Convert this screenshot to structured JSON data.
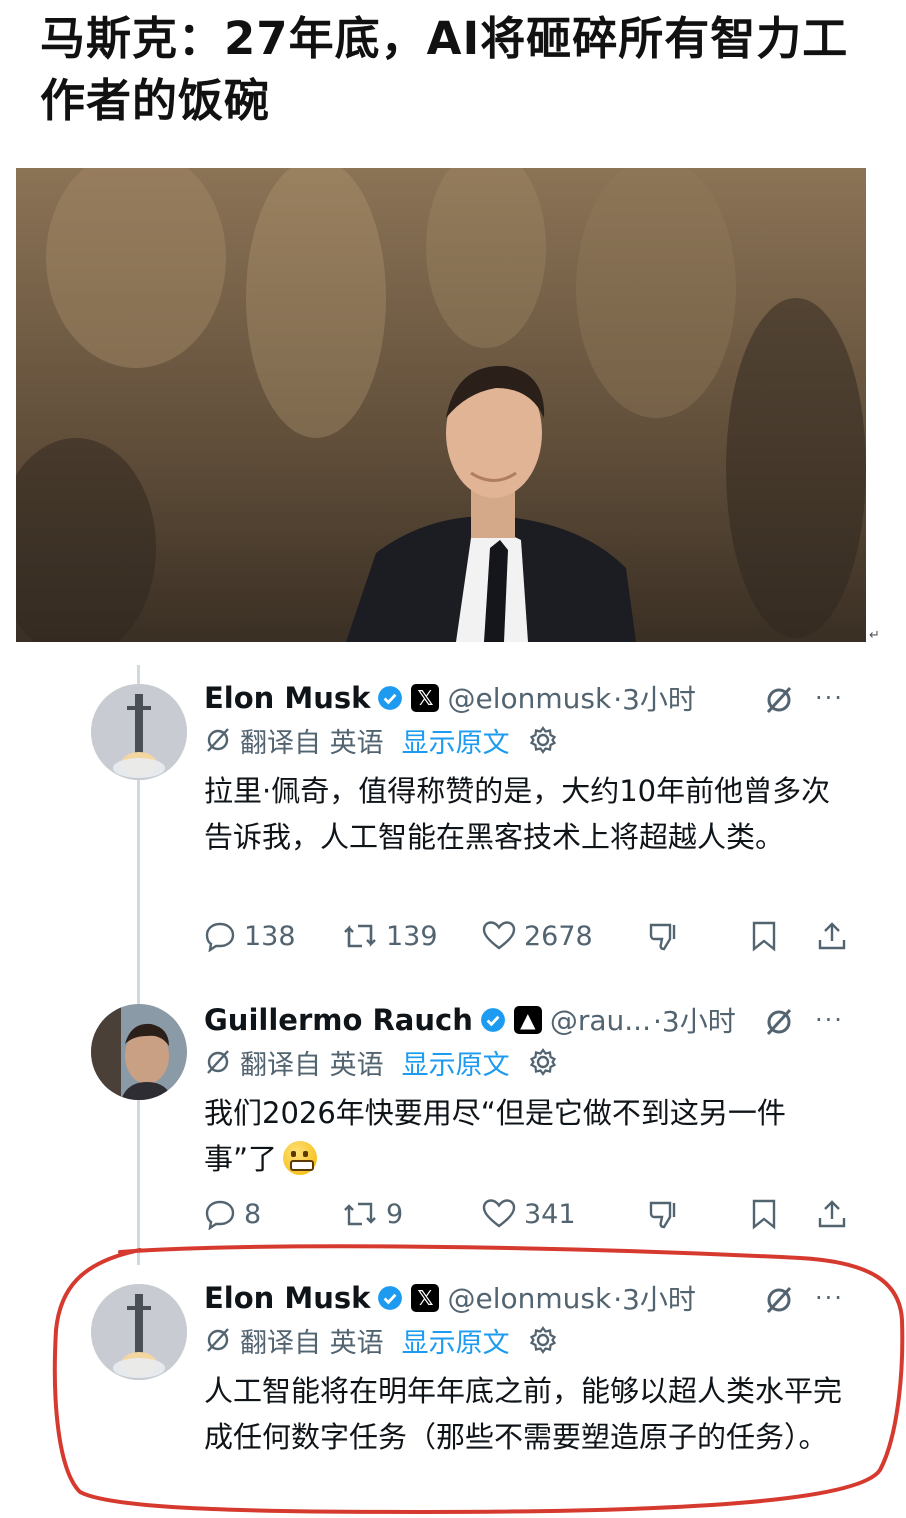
{
  "headline": "马斯克：27年底，AI将砸碎所有智力工作者的饭碗",
  "photo_caption_mark": "↵",
  "translate": {
    "prefix": "翻译自 英语",
    "show_original": "显示原文"
  },
  "tweets": [
    {
      "name": "Elon Musk",
      "badge_icon": "x-logo",
      "badge_char": "𝕏",
      "handle": "@elonmusk",
      "time": "·3小时",
      "text": "拉里·佩奇，值得称赞的是，大约10年前他曾多次告诉我，人工智能在黑客技术上将超越人类。",
      "replies": "138",
      "reposts": "139",
      "likes": "2678"
    },
    {
      "name": "Guillermo Rauch",
      "badge_icon": "vercel-logo",
      "badge_char": "▲",
      "handle": "@rau...",
      "time": "·3小时",
      "text": "我们2026年快要用尽“但是它做不到这另一件事”了",
      "emoji": "grimacing-face",
      "replies": "8",
      "reposts": "9",
      "likes": "341"
    },
    {
      "name": "Elon Musk",
      "badge_icon": "x-logo",
      "badge_char": "𝕏",
      "handle": "@elonmusk",
      "time": "·3小时",
      "text": "人工智能将在明年年底之前，能够以超人类水平完成任何数字任务（那些不需要塑造原子的任务）。"
    }
  ],
  "colors": {
    "accent": "#1d9bf0",
    "muted": "#536471",
    "highlight_ring": "#d63a2f"
  }
}
